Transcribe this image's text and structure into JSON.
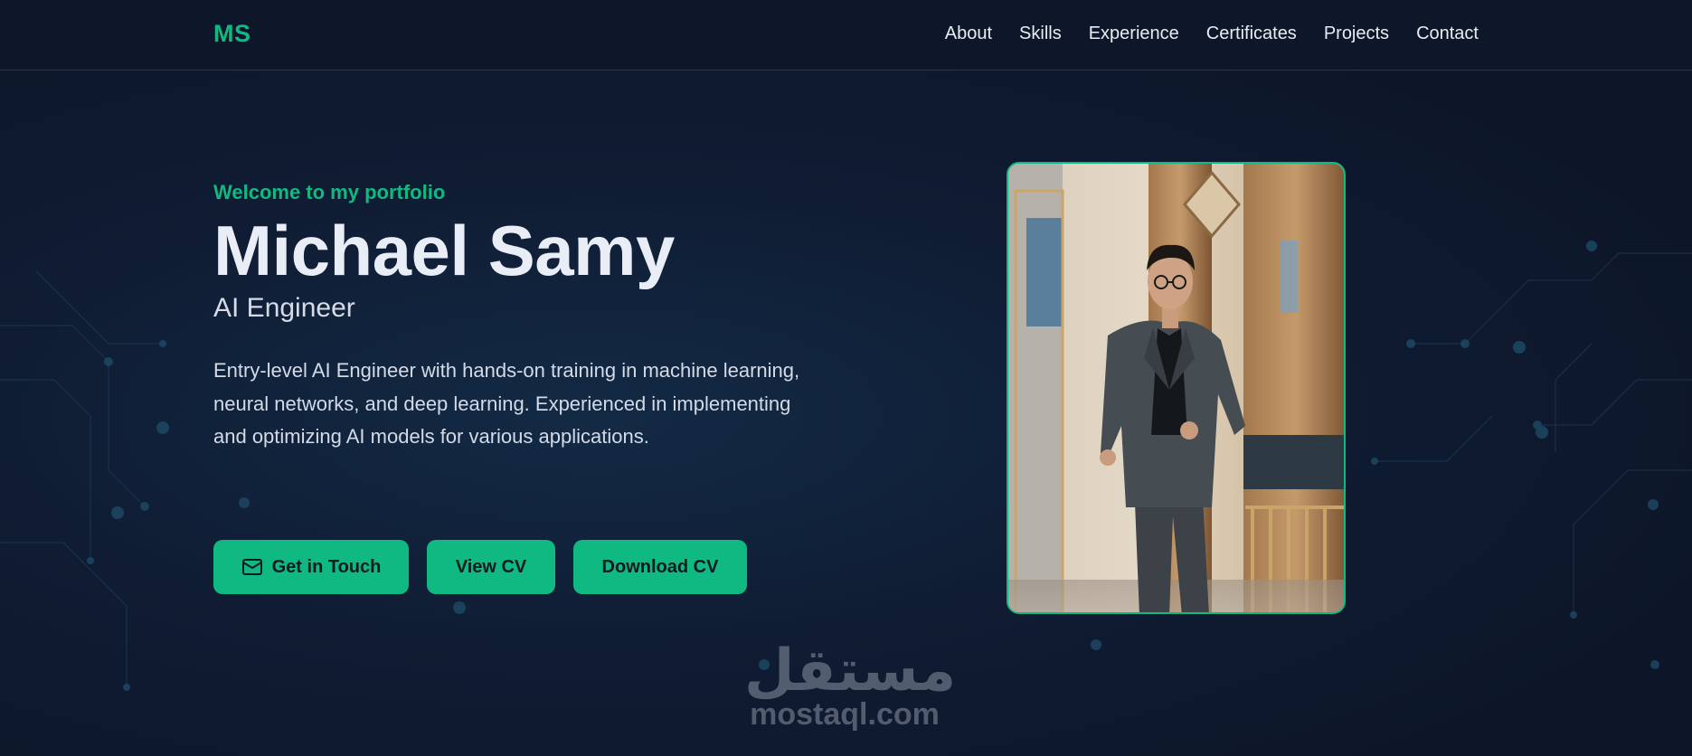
{
  "nav": {
    "logo": "MS",
    "links": [
      "About",
      "Skills",
      "Experience",
      "Certificates",
      "Projects",
      "Contact"
    ]
  },
  "hero": {
    "welcome": "Welcome to my portfolio",
    "name": "Michael Samy",
    "role": "AI Engineer",
    "description": "Entry-level AI Engineer with hands-on training in machine learning, neural networks, and deep learning. Experienced in implementing and optimizing AI models for various applications.",
    "buttons": {
      "get_in_touch": "Get in Touch",
      "view_cv": "View CV",
      "download_cv": "Download CV"
    }
  },
  "watermark": {
    "arabic": "مستقل",
    "latin": "mostaql.com"
  },
  "colors": {
    "accent": "#10b981",
    "background": "#0e1729",
    "text": "#e8edf6"
  },
  "icons": {
    "get_in_touch": "mail-icon"
  }
}
